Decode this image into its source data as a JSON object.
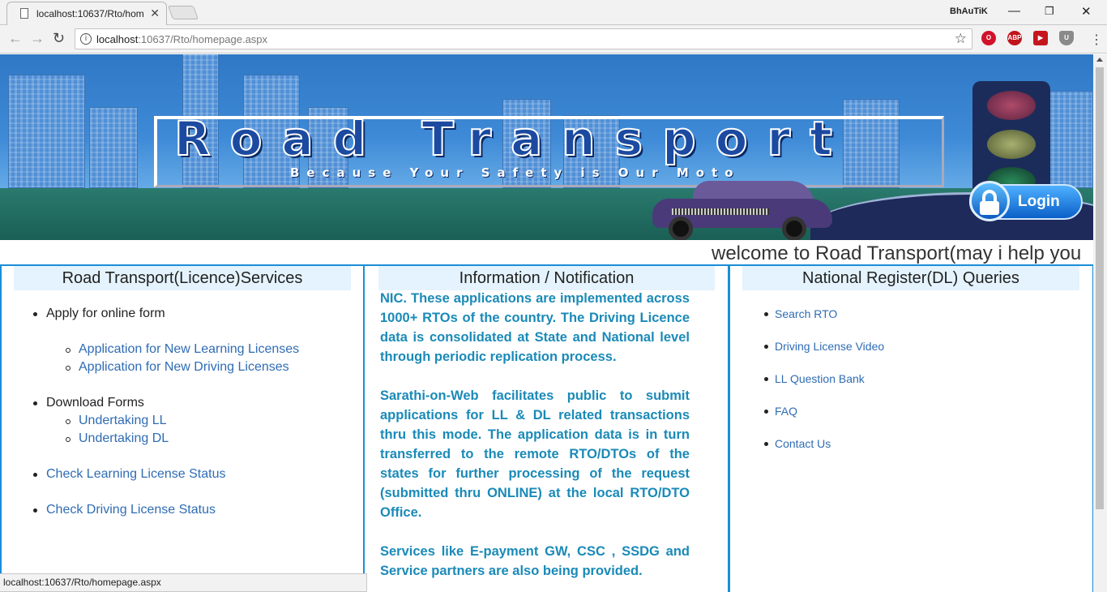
{
  "browser": {
    "tab_title": "localhost:10637/Rto/hom",
    "user_label": "BhAuTiK",
    "url_host": "localhost",
    "url_rest": ":10637/Rto/homepage.aspx",
    "status_url": "localhost:10637/Rto/homepage.aspx",
    "extensions": [
      "opera-icon",
      "adblock-icon",
      "video-icon",
      "shield-icon"
    ]
  },
  "banner": {
    "title": "Road Transport",
    "tagline": "Because Your Safety is Our Moto",
    "login_label": "Login"
  },
  "marquee": "welcome to Road Transport(may i help you",
  "services": {
    "heading": "Road Transport(Licence)Services",
    "apply_label": "Apply for online form",
    "apply_links": [
      "Application for New Learning Licenses",
      "Application for New Driving Licenses"
    ],
    "download_label": "Download Forms",
    "download_links": [
      "Undertaking LL",
      "Undertaking DL"
    ],
    "check_ll": "Check Learning License Status",
    "check_dl": "Check Driving License Status"
  },
  "notification": {
    "heading": "Information / Notification",
    "paragraphs": [
      "NIC. These applications are implemented across 1000+ RTOs of the country. The Driving Licence data is consolidated at State and National level through periodic replication process.",
      "Sarathi-on-Web facilitates public to submit applications for LL & DL related transactions thru this mode. The application data is in turn transferred to the remote RTO/DTOs of the states for further processing of the request (submitted thru ONLINE) at the local RTO/DTO Office.",
      "Services like E-payment GW, CSC , SSDG and Service partners are also being provided."
    ]
  },
  "queries": {
    "heading": "National Register(DL) Queries",
    "links": [
      "Search RTO",
      "Driving License Video",
      "LL Question Bank",
      "FAQ",
      "Contact Us"
    ]
  },
  "colors": {
    "accent": "#1a8ed8",
    "link": "#2f6cb4",
    "notification_text": "#1a8ab8",
    "header_bg": "#e4f3fd"
  }
}
